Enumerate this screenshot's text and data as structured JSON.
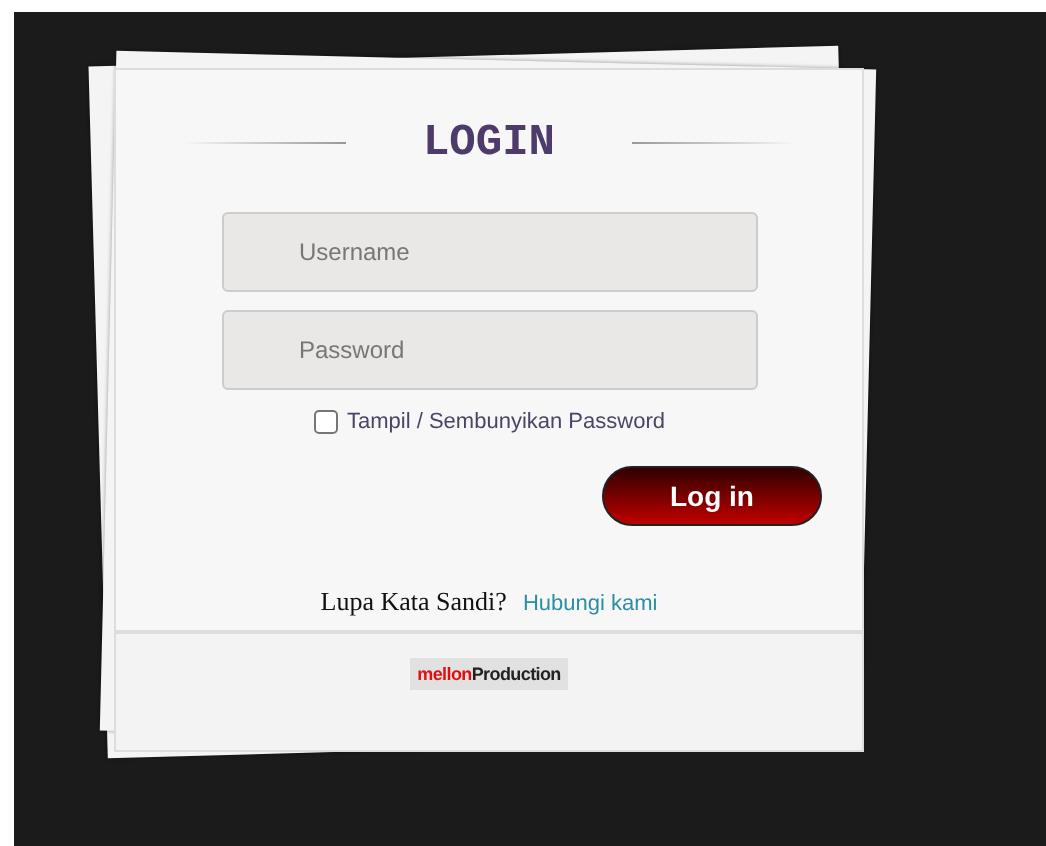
{
  "login_card": {
    "title": "LOGIN",
    "fields": [
      {
        "placeholder": "Username"
      },
      {
        "placeholder": "Password"
      }
    ],
    "show_password": {
      "label": "Tampil / Sembunyikan Password",
      "checked": false
    },
    "submit_button": "Log in",
    "forgot": {
      "text": "Lupa Kata Sandi?",
      "link": "Hubungi kami"
    },
    "footer_logo": {
      "accent": "mellon",
      "rest": "Production"
    }
  }
}
